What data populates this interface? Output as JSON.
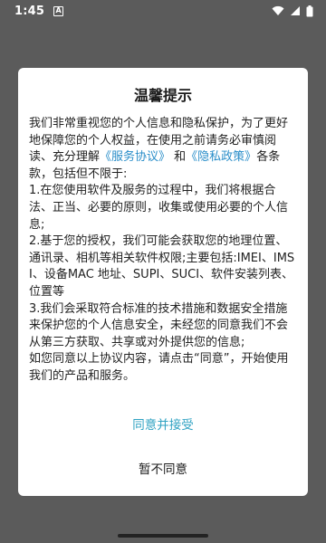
{
  "status_bar": {
    "time": "1:45",
    "notification_letter": "A"
  },
  "dialog": {
    "title": "温馨提示",
    "intro_before": "我们非常重视您的个人信息和隐私保护，为了更好地保障您的个人权益，在使用之前请务必审慎阅读、充分理解",
    "service_agreement_link": "《服务协议》",
    "and": " 和",
    "privacy_policy_link": "《隐私政策》",
    "intro_after": "各条款，包括但不限于:",
    "item1": "1.在您使用软件及服务的过程中，我们将根据合法、正当、必要的原则，收集或使用必要的个人信息;",
    "item2": "2.基于您的授权，我们可能会获取您的地理位置、通讯录、相机等相关软件权限;主要包括:IMEI、IMSI、设备MAC 地址、SUPI、SUCI、软件安装列表、位置等",
    "item3": "3.我们会采取符合标准的技术措施和数据安全措施来保护您的个人信息安全，未经您的同意我们不会从第三方获取、共享或对外提供您的信息;",
    "closing": "如您同意以上协议内容，请点击“同意”，开始使用我们的产品和服务。",
    "accept_button": "同意并接受",
    "decline_button": "暂不同意"
  },
  "colors": {
    "overlay": "#5b5b5b",
    "link": "#2a8ec9",
    "accept": "#2fa2c2"
  },
  "icons": [
    "wifi-icon",
    "signal-icon",
    "battery-icon"
  ]
}
